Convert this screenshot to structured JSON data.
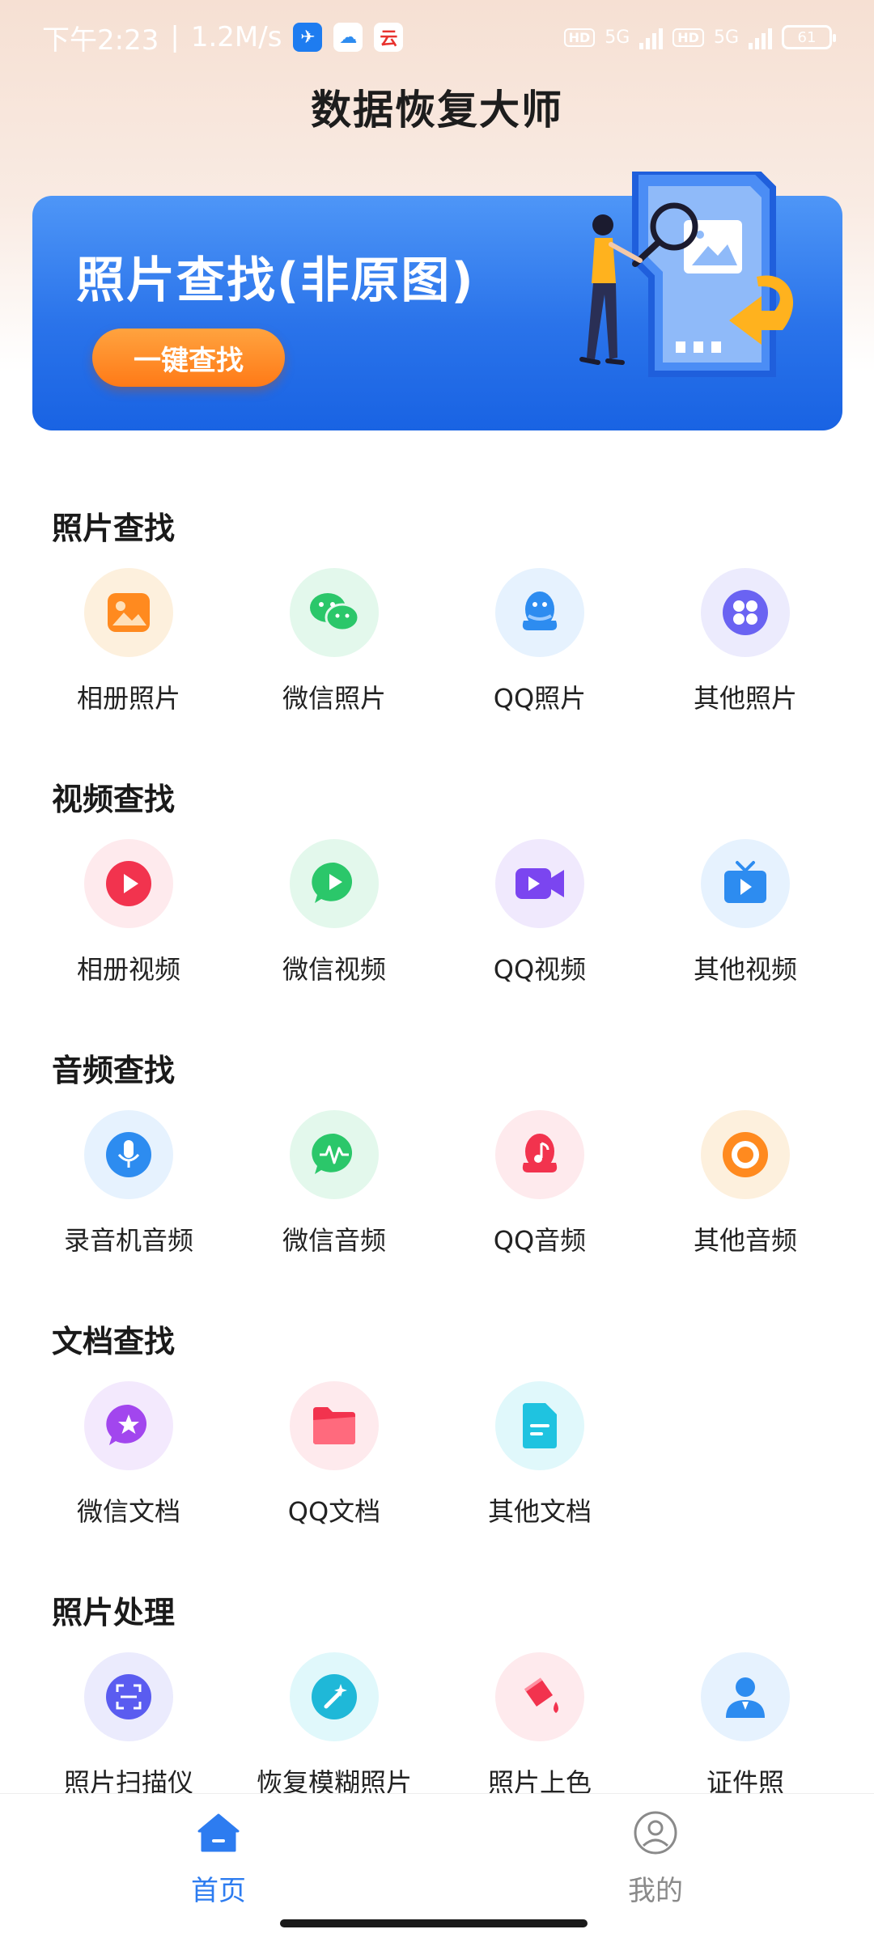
{
  "status_bar": {
    "time": "下午2:23",
    "speed": "1.2M/s",
    "separator": "|",
    "network_label": "5G",
    "battery": "61"
  },
  "app": {
    "title": "数据恢复大师"
  },
  "banner": {
    "title": "照片查找(非原图)",
    "button_label": "一键查找"
  },
  "sections": [
    {
      "title": "照片查找",
      "items": [
        {
          "label": "相册照片",
          "icon": "gallery-icon",
          "bg": "#fdf0dd",
          "color": "#ff8a1f"
        },
        {
          "label": "微信照片",
          "icon": "wechat-icon",
          "bg": "#e3f8ec",
          "color": "#2bc76a"
        },
        {
          "label": "QQ照片",
          "icon": "qq-icon",
          "bg": "#e6f2fe",
          "color": "#2d8cf0"
        },
        {
          "label": "其他照片",
          "icon": "apps-icon",
          "bg": "#ecebfd",
          "color": "#6a63f2"
        }
      ]
    },
    {
      "title": "视频查找",
      "items": [
        {
          "label": "相册视频",
          "icon": "play-circle-icon",
          "bg": "#feeaed",
          "color": "#f2334e"
        },
        {
          "label": "微信视频",
          "icon": "wechat-video-icon",
          "bg": "#e3f8ec",
          "color": "#2bc76a"
        },
        {
          "label": "QQ视频",
          "icon": "video-camera-icon",
          "bg": "#f0e9fd",
          "color": "#7b45f0"
        },
        {
          "label": "其他视频",
          "icon": "tv-icon",
          "bg": "#e6f2fe",
          "color": "#2d8cf0"
        }
      ]
    },
    {
      "title": "音频查找",
      "items": [
        {
          "label": "录音机音频",
          "icon": "microphone-icon",
          "bg": "#e6f2fe",
          "color": "#2d8cf0"
        },
        {
          "label": "微信音频",
          "icon": "voice-wave-icon",
          "bg": "#e3f8ec",
          "color": "#2bc76a"
        },
        {
          "label": "QQ音频",
          "icon": "qq-music-icon",
          "bg": "#feeaed",
          "color": "#f2334e"
        },
        {
          "label": "其他音频",
          "icon": "record-icon",
          "bg": "#fdf0dd",
          "color": "#ff8a1f"
        }
      ]
    },
    {
      "title": "文档查找",
      "items": [
        {
          "label": "微信文档",
          "icon": "chat-star-icon",
          "bg": "#f3e9fd",
          "color": "#a246ee"
        },
        {
          "label": "QQ文档",
          "icon": "folder-icon",
          "bg": "#feeaed",
          "color": "#f2334e"
        },
        {
          "label": "其他文档",
          "icon": "document-icon",
          "bg": "#e0f8fb",
          "color": "#1fc3e0"
        }
      ]
    },
    {
      "title": "照片处理",
      "items": [
        {
          "label": "照片扫描仪",
          "icon": "scan-icon",
          "bg": "#ebebfd",
          "color": "#5a5cf0"
        },
        {
          "label": "恢复模糊照片",
          "icon": "magic-wand-icon",
          "bg": "#e0f8fb",
          "color": "#1fb8d8"
        },
        {
          "label": "照片上色",
          "icon": "paint-bucket-icon",
          "bg": "#feeaed",
          "color": "#f2334e"
        },
        {
          "label": "证件照",
          "icon": "id-photo-icon",
          "bg": "#e6f2fe",
          "color": "#2d8cf0"
        }
      ]
    }
  ],
  "bottom_nav": {
    "home_label": "首页",
    "mine_label": "我的",
    "active_color": "#2d7cf0",
    "inactive_color": "#8a8a8a"
  }
}
